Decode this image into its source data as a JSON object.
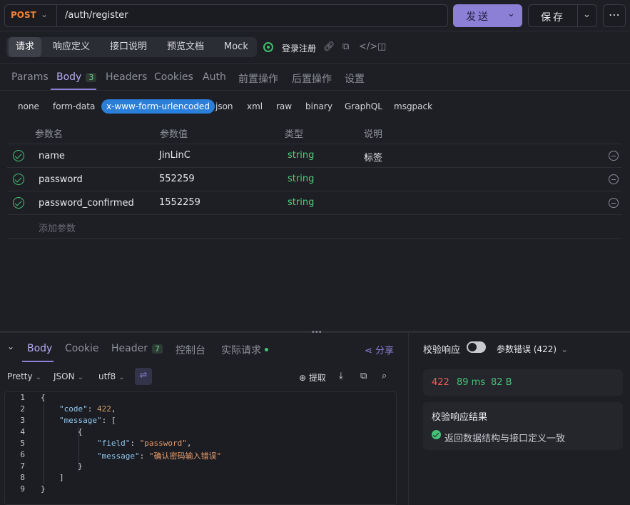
{
  "request": {
    "method": "POST",
    "url": "/auth/register",
    "send_label": "发送",
    "save_label": "保存"
  },
  "main_tabs": [
    "请求",
    "响应定义",
    "接口说明",
    "预览文档",
    "Mock"
  ],
  "api_name": "登录注册",
  "sub_tabs": [
    {
      "label": "Params"
    },
    {
      "label": "Body",
      "badge": "3"
    },
    {
      "label": "Headers"
    },
    {
      "label": "Cookies"
    },
    {
      "label": "Auth"
    },
    {
      "label": "前置操作"
    },
    {
      "label": "后置操作"
    },
    {
      "label": "设置"
    }
  ],
  "body_types": [
    "none",
    "form-data",
    "x-www-form-urlencoded",
    "json",
    "xml",
    "raw",
    "binary",
    "GraphQL",
    "msgpack"
  ],
  "params_table": {
    "headers": [
      "参数名",
      "参数值",
      "类型",
      "说明"
    ],
    "rows": [
      {
        "name": "name",
        "value": "JinLinC",
        "type": "string",
        "desc": "标签"
      },
      {
        "name": "password",
        "value": "552259",
        "type": "string",
        "desc": ""
      },
      {
        "name": "password_confirmed",
        "value": "1552259",
        "type": "string",
        "desc": ""
      }
    ],
    "add_placeholder": "添加参数"
  },
  "response": {
    "tabs": [
      {
        "label": "Body"
      },
      {
        "label": "Cookie"
      },
      {
        "label": "Header",
        "badge": "7"
      },
      {
        "label": "控制台"
      },
      {
        "label": "实际请求"
      }
    ],
    "share_label": "分享",
    "format": "Pretty",
    "lang": "JSON",
    "encoding": "utf8",
    "extract_label": "提取",
    "code_lines": [
      "1",
      "2",
      "3",
      "4",
      "5",
      "6",
      "7",
      "8",
      "9"
    ],
    "body": {
      "code_key": "\"code\"",
      "code_val": "422",
      "message_key": "\"message\"",
      "field_key": "\"field\"",
      "field_val": "\"password\"",
      "msg_key": "\"message\"",
      "msg_val": "\"确认密码输入错误\""
    }
  },
  "validation": {
    "label": "校验响应",
    "enabled": true,
    "select": "参数错误 (422)",
    "status": "422",
    "time": "89 ms",
    "size": "82 B",
    "result_title": "校验响应结果",
    "result_text": "返回数据结构与接口定义一致"
  },
  "colors": {
    "accent": "#8b7fd6",
    "method": "#f0813a",
    "success": "#46c278",
    "error": "#f05a5a",
    "selected_body_type": "#2b7fd9"
  }
}
